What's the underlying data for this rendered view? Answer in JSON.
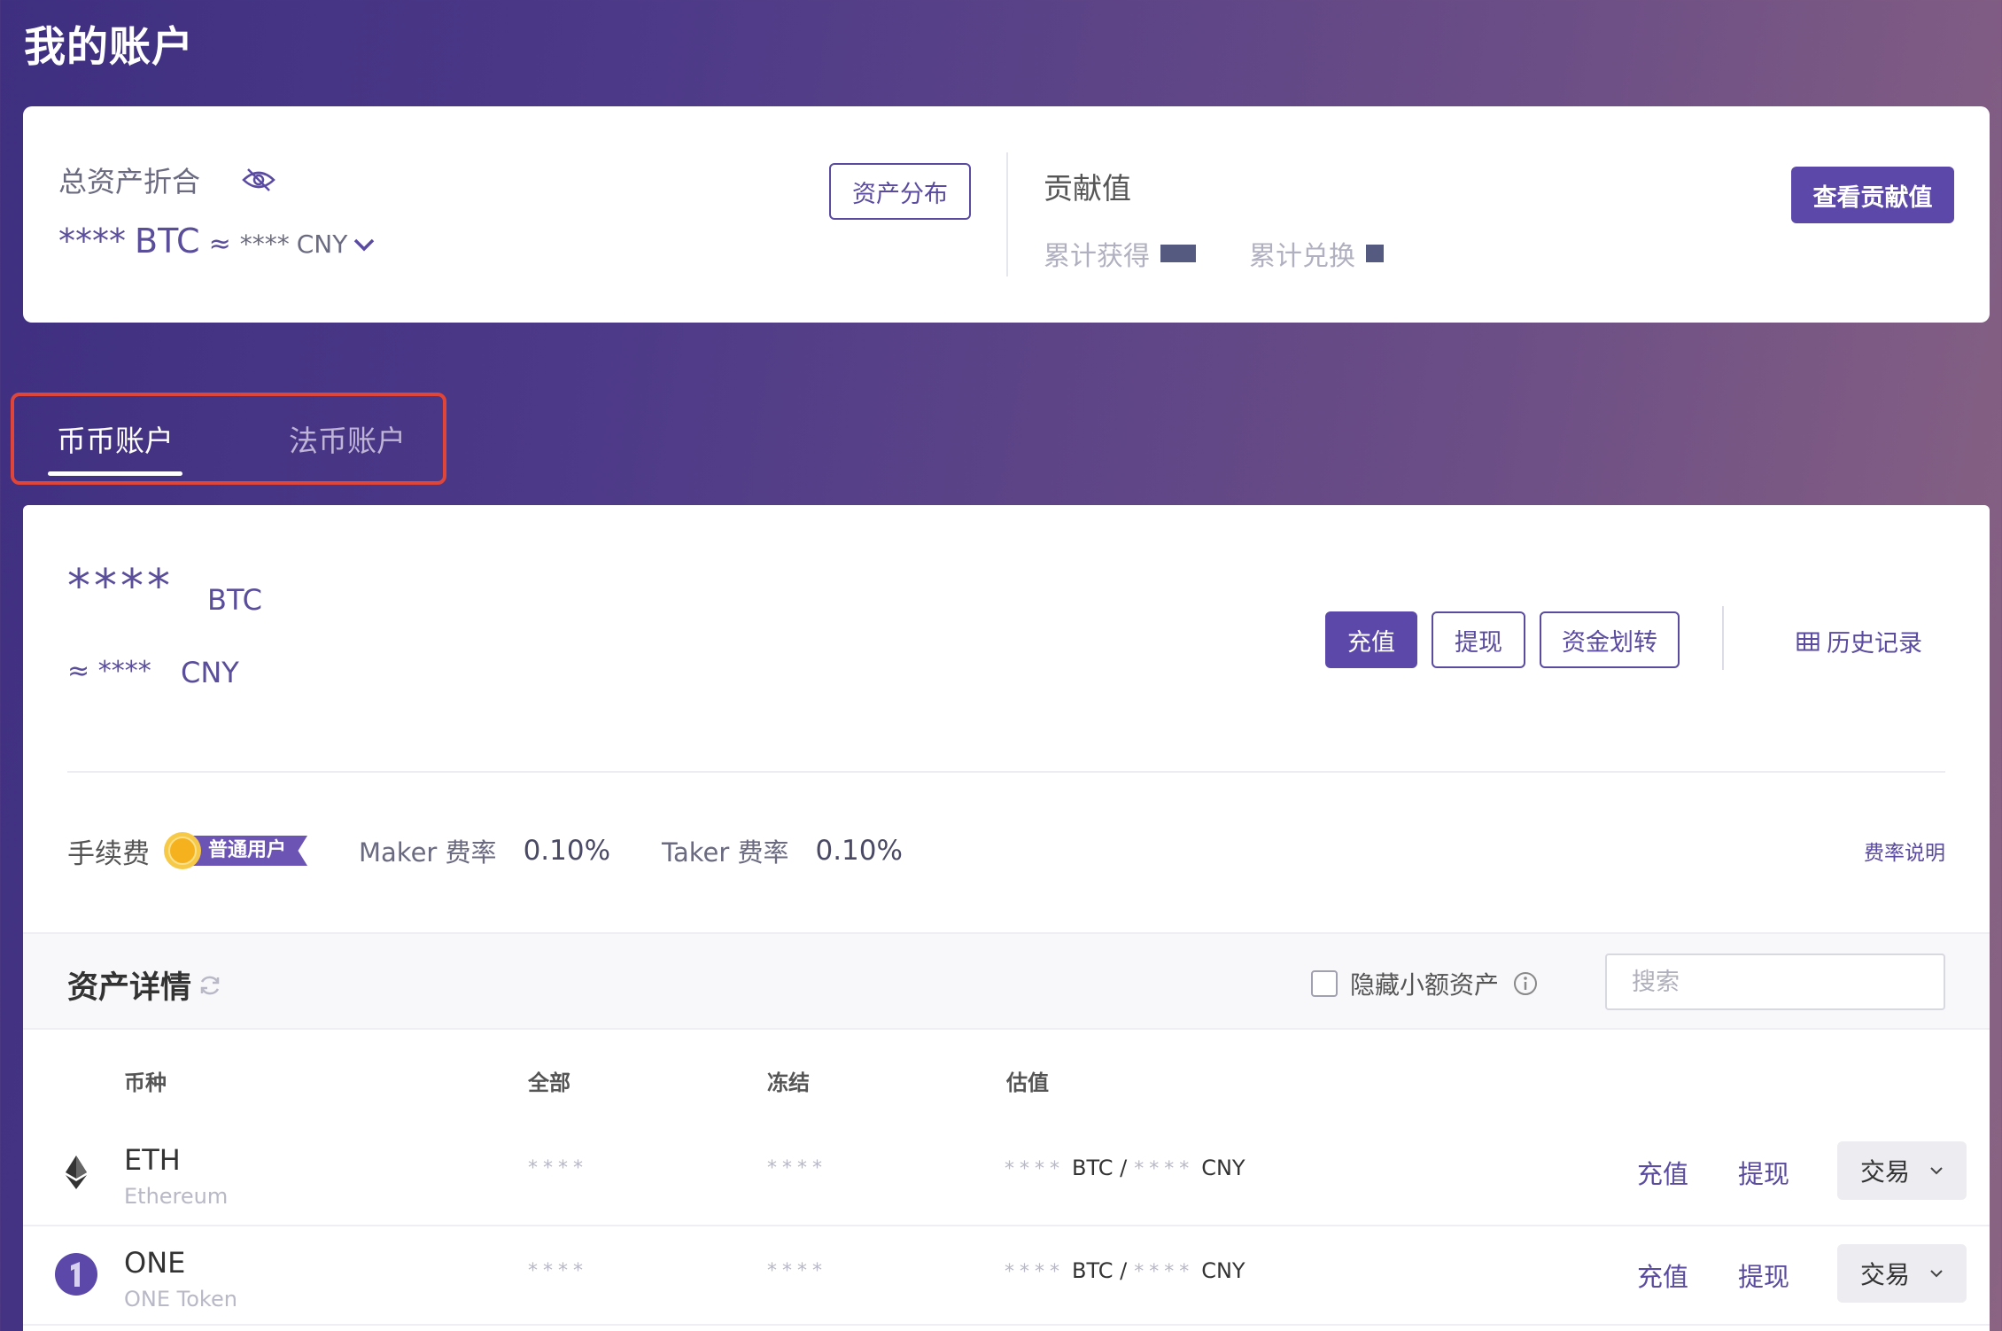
{
  "page_title": "我的账户",
  "summary": {
    "total_label": "总资产折合",
    "total_btc_mask": "****",
    "btc_unit": "BTC",
    "approx": "≈",
    "total_cny_mask": "****",
    "cny_unit": "CNY",
    "distribution_button": "资产分布",
    "contribution_title": "贡献值",
    "earned_label": "累计获得",
    "redeemed_label": "累计兑换",
    "contribution_button": "查看贡献值"
  },
  "tabs": [
    {
      "label": "币币账户",
      "active": true
    },
    {
      "label": "法币账户",
      "active": false
    }
  ],
  "balance": {
    "btc_mask": "****",
    "btc_unit": "BTC",
    "approx": "≈",
    "cny_mask": "****",
    "cny_unit": "CNY"
  },
  "actions": {
    "deposit": "充值",
    "withdraw": "提现",
    "transfer": "资金划转",
    "history": "历史记录"
  },
  "fees": {
    "label": "手续费",
    "tier_badge": "普通用户",
    "maker_label": "Maker 费率",
    "maker_value": "0.10%",
    "taker_label": "Taker 费率",
    "taker_value": "0.10%",
    "explain_link": "费率说明"
  },
  "assets": {
    "title": "资产详情",
    "hide_small_label": "隐藏小额资产",
    "search_placeholder": "搜索",
    "columns": [
      "币种",
      "全部",
      "冻结",
      "估值"
    ],
    "rows": [
      {
        "symbol": "ETH",
        "name": "Ethereum",
        "total": "****",
        "frozen": "****",
        "est_btc": "****",
        "est_btc_unit": "BTC /",
        "est_cny": "****",
        "est_cny_unit": "CNY",
        "deposit": "充值",
        "withdraw": "提现",
        "trade": "交易"
      },
      {
        "symbol": "ONE",
        "name": "ONE Token",
        "total": "****",
        "frozen": "****",
        "est_btc": "****",
        "est_btc_unit": "BTC /",
        "est_cny": "****",
        "est_cny_unit": "CNY",
        "deposit": "充值",
        "withdraw": "提现",
        "trade": "交易"
      }
    ]
  },
  "colors": {
    "accent": "#5c48a8",
    "highlight_border": "#e0453a"
  },
  "icons": [
    "eye-slash-icon",
    "chevron-down-icon",
    "grid-icon",
    "sun-badge-icon",
    "refresh-icon",
    "info-icon",
    "ethereum-icon",
    "one-token-icon"
  ]
}
